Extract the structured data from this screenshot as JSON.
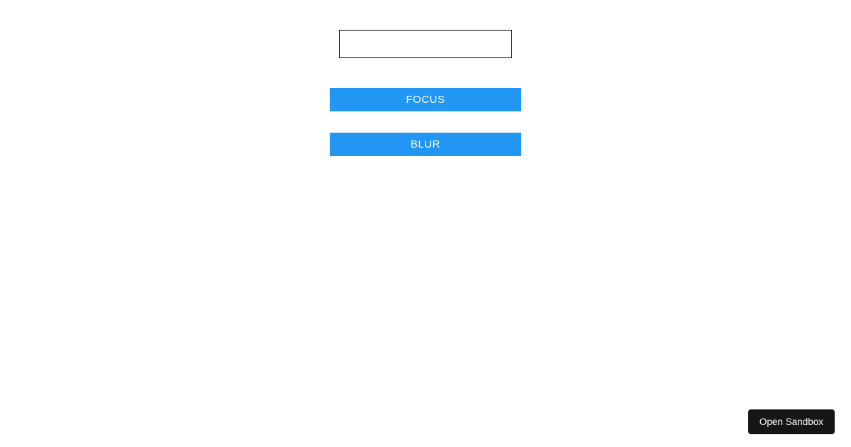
{
  "main": {
    "input": {
      "value": ""
    },
    "buttons": {
      "focus_label": "FOCUS",
      "blur_label": "BLUR"
    }
  },
  "footer": {
    "open_sandbox_label": "Open Sandbox"
  }
}
